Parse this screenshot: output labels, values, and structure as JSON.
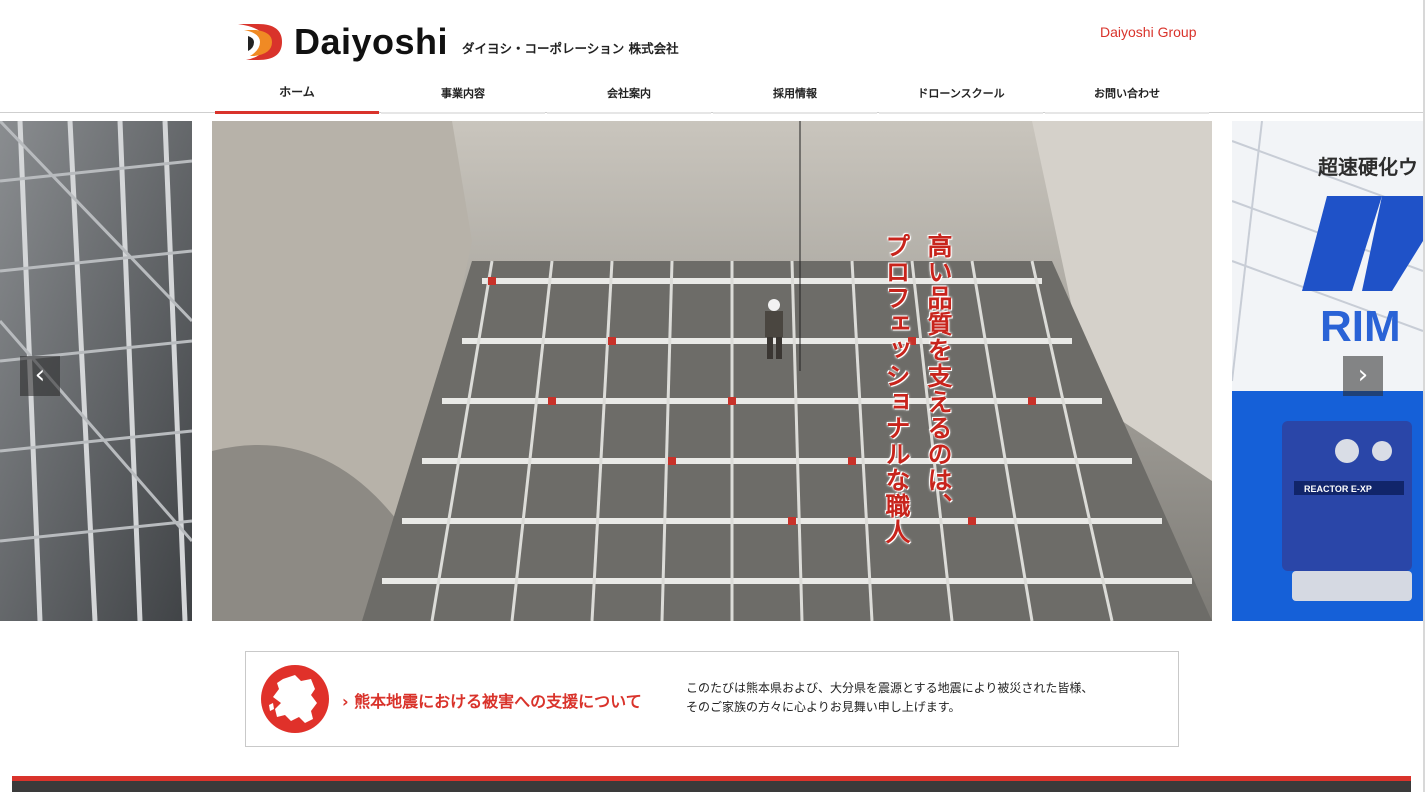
{
  "brand": {
    "name": "Daiyoshi",
    "subtitle": "ダイヨシ・コーポレーション 株式会社",
    "group_link": "Daiyoshi Group",
    "accent": "#d9332b"
  },
  "nav": {
    "items": [
      {
        "label": "ホーム",
        "active": true
      },
      {
        "label": "事業内容",
        "active": false
      },
      {
        "label": "会社案内",
        "active": false
      },
      {
        "label": "採用情報",
        "active": false
      },
      {
        "label": "ドローンスクール",
        "active": false
      },
      {
        "label": "お問い合わせ",
        "active": false
      }
    ]
  },
  "slider": {
    "catch_lines": [
      "高い品質を支えるのは、",
      "プロフェッショナルな職人"
    ],
    "next_slide_title": "超速硬化ウ",
    "next_slide_brand": "RIM",
    "next_slide_machine": "REACTOR E-XP",
    "prev_icon": "chevron-left-icon",
    "next_icon": "chevron-right-icon"
  },
  "notice": {
    "icon": "kumamoto-map-icon",
    "title": "熊本地震における被害への支援について",
    "title_prefix": "›",
    "text_lines": [
      "このたびは熊本県および、大分県を震源とする地震により被災された皆様、",
      "そのご家族の方々に心よりお見舞い申し上げます。"
    ]
  }
}
